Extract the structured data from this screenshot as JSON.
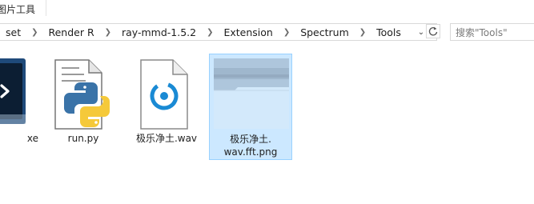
{
  "ribbon": {
    "context_tab_label": "图片工具"
  },
  "address": {
    "breadcrumbs": [
      "set",
      "Render R",
      "ray-mmd-1.5.2",
      "Extension",
      "Spectrum",
      "Tools"
    ]
  },
  "search": {
    "placeholder": "搜索\"Tools\""
  },
  "files": [
    {
      "name": "xe",
      "type": "exe"
    },
    {
      "name": "run.py",
      "type": "python"
    },
    {
      "name": "极乐净土.wav",
      "type": "audio"
    },
    {
      "name": "极乐净土.wav.fft.png",
      "name_line1": "极乐净土.",
      "name_line2": "wav.fft.png",
      "type": "image",
      "selected": true
    }
  ],
  "colors": {
    "selection_bg": "#cce8ff",
    "selection_border": "#99d1ff",
    "audio_accent": "#1a8ad4"
  }
}
